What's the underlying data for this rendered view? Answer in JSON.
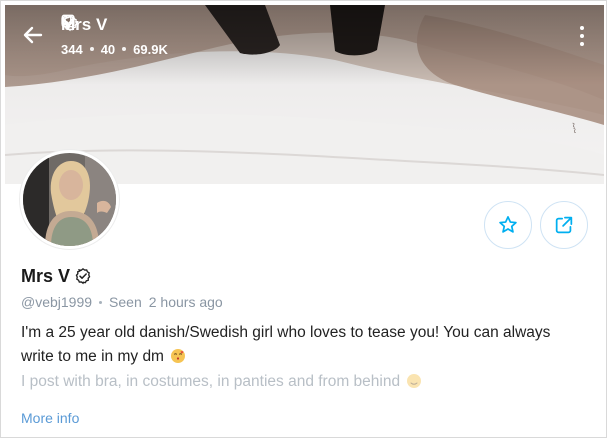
{
  "header": {
    "title": "Mrs V",
    "stats": {
      "photos": "344",
      "videos": "40",
      "likes": "69.9K"
    }
  },
  "profile": {
    "name": "Mrs V",
    "handle": "@vebj1999",
    "seen_label": "Seen",
    "seen_time": "2 hours ago",
    "bio_line1": "I'm a 25 year old danish/Swedish girl who loves to tease you! You can always write to me in my dm",
    "bio_line2": "I post with bra, in costumes, in panties and from behind",
    "more_info": "More info"
  },
  "colors": {
    "accent": "#00aff0",
    "link": "#5a9ad6",
    "muted": "#8a96a3"
  },
  "icons": {
    "back": "arrow-left-icon",
    "verified": "verified-check-icon",
    "photos": "image-icon",
    "videos": "video-icon",
    "likes": "heart-icon",
    "menu": "kebab-menu-icon",
    "favorite": "star-icon",
    "share": "share-icon"
  }
}
